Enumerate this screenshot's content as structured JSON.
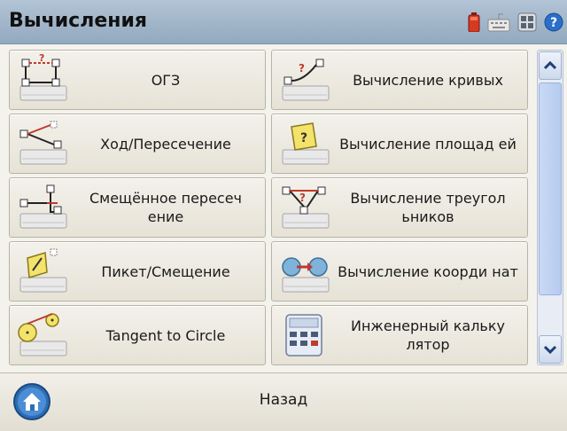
{
  "window": {
    "title": "Вычисления",
    "status_icons": [
      "battery-icon",
      "keyboard-icon",
      "device-icon",
      "help-icon"
    ]
  },
  "menu": {
    "tiles": [
      {
        "label": "ОГЗ",
        "icon": "inverse-traverse-icon"
      },
      {
        "label": "Вычисление кривых",
        "icon": "curve-calc-icon"
      },
      {
        "label": "Ход/Пересечение",
        "icon": "traverse-intersection-icon"
      },
      {
        "label": "Вычисление площад ей",
        "icon": "area-calc-icon"
      },
      {
        "label": "Смещённое пересеч ение",
        "icon": "offset-intersection-icon"
      },
      {
        "label": "Вычисление треугол ьников",
        "icon": "triangle-calc-icon"
      },
      {
        "label": "Пикет/Смещение",
        "icon": "station-offset-icon"
      },
      {
        "label": "Вычисление коорди нат",
        "icon": "coordinate-calc-icon"
      },
      {
        "label": "Tangent to Circle",
        "icon": "tangent-circle-icon"
      },
      {
        "label": "Инженерный кальку лятор",
        "icon": "calculator-icon"
      }
    ]
  },
  "scrollbar": {
    "up_icon": "chevron-up-icon",
    "down_icon": "chevron-down-icon"
  },
  "footer": {
    "back_label": "Назад",
    "back_icon": "home-icon"
  }
}
